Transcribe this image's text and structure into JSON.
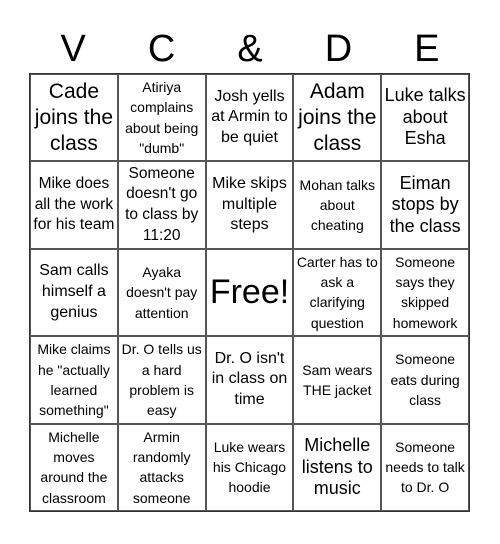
{
  "header": {
    "letters": [
      "V",
      "C",
      "&",
      "D",
      "E"
    ]
  },
  "grid": {
    "rows": [
      [
        "Cade joins the class",
        "Atiriya complains about being \"dumb\"",
        "Josh yells at Armin to be quiet",
        "Adam joins the class",
        "Luke talks about Esha"
      ],
      [
        "Mike does all the work for his team",
        "Someone doesn't go to class by 11:20",
        "Mike skips multiple steps",
        "Mohan talks about cheating",
        "Eiman stops by the class"
      ],
      [
        "Sam calls himself a genius",
        "Ayaka doesn't pay attention",
        "Free!",
        "Carter has to ask a clarifying question",
        "Someone says they skipped homework"
      ],
      [
        "Mike claims he \"actually learned something\"",
        "Dr. O tells us a hard problem is easy",
        "Dr. O isn't in class on time",
        "Sam wears THE jacket",
        "Someone eats during class"
      ],
      [
        "Michelle moves around the classroom",
        "Armin randomly attacks someone",
        "Luke wears his Chicago hoodie",
        "Michelle listens to music",
        "Someone needs to talk to Dr. O"
      ]
    ]
  }
}
